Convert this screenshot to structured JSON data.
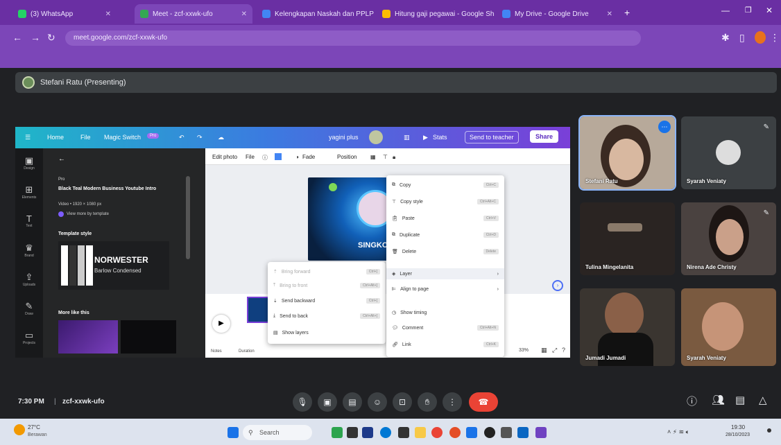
{
  "browser": {
    "tabs": [
      {
        "label": "(3) WhatsApp",
        "favicon_color": "#25d366"
      },
      {
        "label": "Meet - zcf-xxwk-ufo",
        "favicon_color": "#34a853"
      },
      {
        "label": "Kelengkapan Naskah dan PPLP",
        "favicon_color": "#4285f4"
      },
      {
        "label": "Hitung gaji pegawai - Google Sh",
        "favicon_color": "#fbbc04"
      },
      {
        "label": "My Drive - Google Drive",
        "favicon_color": "#4285f4"
      }
    ],
    "url": "meet.google.com/zcf-xxwk-ufo",
    "new_tab": "+"
  },
  "meet": {
    "presenter_label": "Stefani Ratu (Presenting)",
    "time": "7:30 PM",
    "separator": "|",
    "meeting_code": "zcf-xxwk-ufo",
    "participants": [
      {
        "name": "Stefani Ratu"
      },
      {
        "name": "Syarah Veniaty"
      },
      {
        "name": "Tulina Mingelanita"
      },
      {
        "name": "Nirena Ade Christy"
      },
      {
        "name": "Jumadi Jumadi"
      },
      {
        "name": "Syarah Veniaty"
      }
    ],
    "controls": [
      "mic",
      "camera",
      "captions",
      "emoji",
      "present",
      "raise-hand",
      "more",
      "end-call"
    ],
    "right_controls": [
      "info",
      "people",
      "chat",
      "activities"
    ]
  },
  "canva": {
    "nav": {
      "home": "Home",
      "file": "File",
      "magic_switch": "Magic Switch",
      "badge": "Pro",
      "title": "yagini plus",
      "stats": "Stats",
      "send_teacher": "Send to teacher",
      "share": "Share"
    },
    "sidebar": [
      "Design",
      "Elements",
      "Text",
      "Brand",
      "Uploads",
      "Draw",
      "Projects"
    ],
    "panel": {
      "tag": "Pro",
      "template_title": "Black Teal Modern Business Youtube Intro",
      "template_meta": "Video • 1920 × 1080 px",
      "template_link": "View more by template",
      "style_heading": "Template style",
      "font_name": "NORWESTER",
      "font_sub": "Barlow Condensed",
      "more_heading": "More like this"
    },
    "toolbar": {
      "edit_photo": "Edit photo",
      "file": "File",
      "fade": "Fade",
      "position": "Position"
    },
    "context_menu": [
      {
        "label": "Copy",
        "kbd": "Ctrl+C"
      },
      {
        "label": "Copy style",
        "kbd": "Ctrl+Alt+C"
      },
      {
        "label": "Paste",
        "kbd": "Ctrl+V"
      },
      {
        "label": "Duplicate",
        "kbd": "Ctrl+D"
      },
      {
        "label": "Delete",
        "kbd": "Delete"
      },
      {
        "label": "Layer",
        "kbd": ""
      },
      {
        "label": "Align to page",
        "kbd": ""
      },
      {
        "label": "Show timing",
        "kbd": ""
      },
      {
        "label": "Comment",
        "kbd": "Ctrl+Alt+N"
      },
      {
        "label": "Link",
        "kbd": "Ctrl+K"
      }
    ],
    "layer_menu": [
      {
        "label": "Bring forward",
        "kbd": "Ctrl+]"
      },
      {
        "label": "Bring to front",
        "kbd": "Ctrl+Alt+]"
      },
      {
        "label": "Send backward",
        "kbd": "Ctrl+["
      },
      {
        "label": "Send to back",
        "kbd": "Ctrl+Alt+["
      },
      {
        "label": "Show layers",
        "kbd": ""
      }
    ],
    "footer": {
      "notes": "Notes",
      "duration": "Duration",
      "zoom": "33%"
    },
    "design_text": "SINGKO"
  },
  "taskbar": {
    "weather_temp": "27°C",
    "weather_desc": "Berawan",
    "search_placeholder": "Search",
    "clock_time": "19:30",
    "clock_date": "28/10/2023"
  },
  "colors": {
    "meet_bg": "#202124",
    "browser_purple": "#6a2fa3",
    "end_call": "#ea4335",
    "canva_purple": "#7a3fd8"
  }
}
